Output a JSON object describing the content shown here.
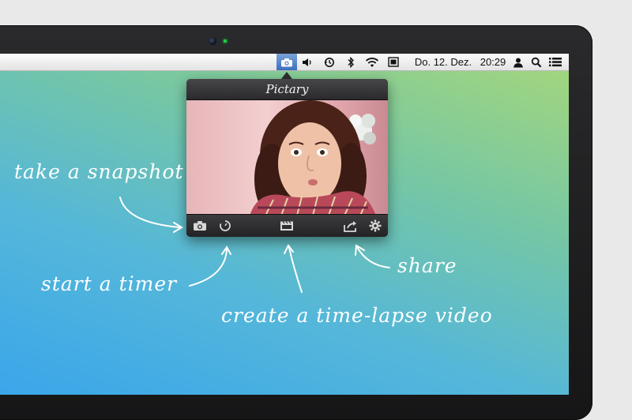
{
  "menubar": {
    "date": "Do. 12. Dez.",
    "time": "20:29",
    "icons": [
      "camera-icon",
      "volume-icon",
      "time-machine-icon",
      "bluetooth-icon",
      "wifi-icon",
      "display-icon",
      "user-icon",
      "search-icon",
      "list-icon"
    ]
  },
  "popup": {
    "title": "Pictary",
    "toolbar": {
      "snapshot_icon": "camera-icon",
      "timer_icon": "timer-icon",
      "timelapse_icon": "film-icon",
      "share_icon": "share-icon",
      "settings_icon": "gear-icon"
    }
  },
  "annotations": {
    "snapshot": "take a snapshot",
    "timer": "start a timer",
    "timelapse": "create a time-lapse video",
    "share": "share"
  }
}
